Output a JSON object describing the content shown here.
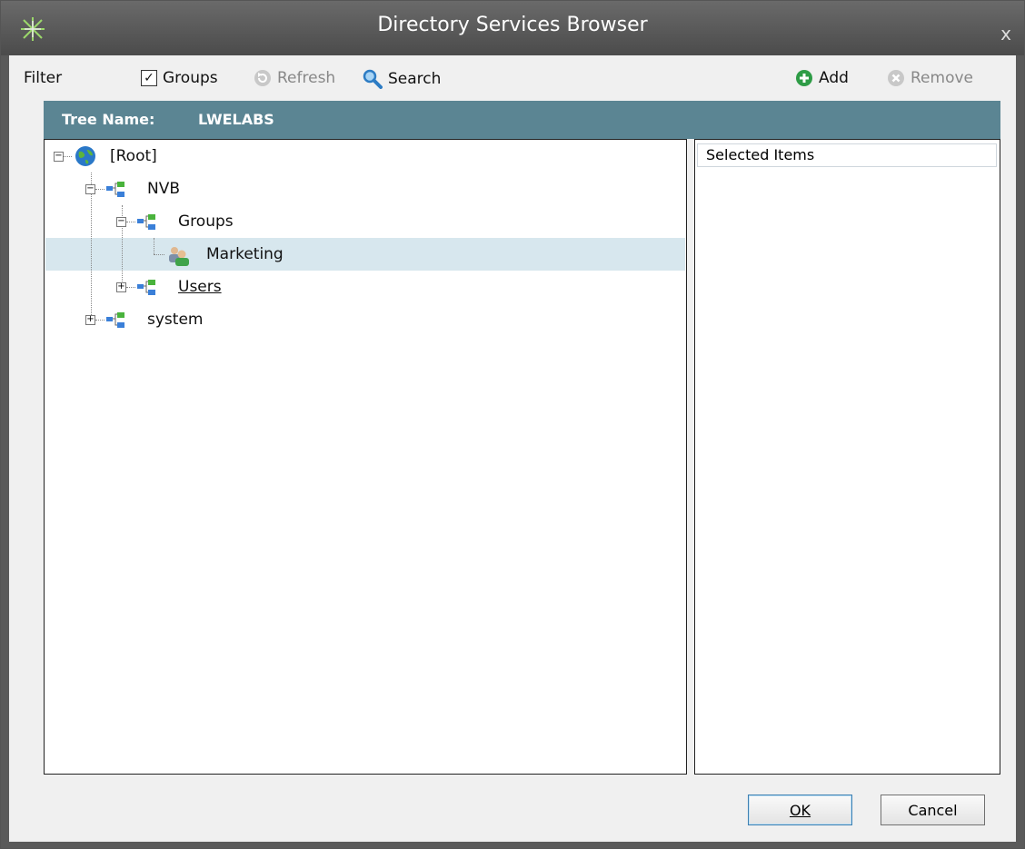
{
  "window": {
    "title": "Directory Services Browser",
    "close_glyph": "x"
  },
  "toolbar": {
    "filter_label": "Filter",
    "groups_label": "Groups",
    "groups_checked": true,
    "refresh_label": "Refresh",
    "search_label": "Search",
    "add_label": "Add",
    "remove_label": "Remove"
  },
  "tree": {
    "name_label": "Tree Name:",
    "name_value": "LWELABS",
    "nodes": [
      {
        "label": "[Root]",
        "icon": "globe-icon",
        "expanded": true
      },
      {
        "label": "NVB",
        "icon": "org-unit-icon",
        "expanded": true
      },
      {
        "label": "Groups",
        "icon": "org-unit-icon",
        "expanded": true
      },
      {
        "label": "Marketing",
        "icon": "group-icon",
        "selected": true
      },
      {
        "label": "Users",
        "icon": "org-unit-icon",
        "expanded": false
      },
      {
        "label": "system",
        "icon": "org-unit-icon",
        "expanded": false
      }
    ]
  },
  "selected_items": {
    "header": "Selected Items"
  },
  "buttons": {
    "ok_label": "OK",
    "cancel_label": "Cancel"
  },
  "colors": {
    "header_bg": "#5b8593",
    "selection_bg": "#d7e7ee",
    "titlebar": "#555555"
  }
}
